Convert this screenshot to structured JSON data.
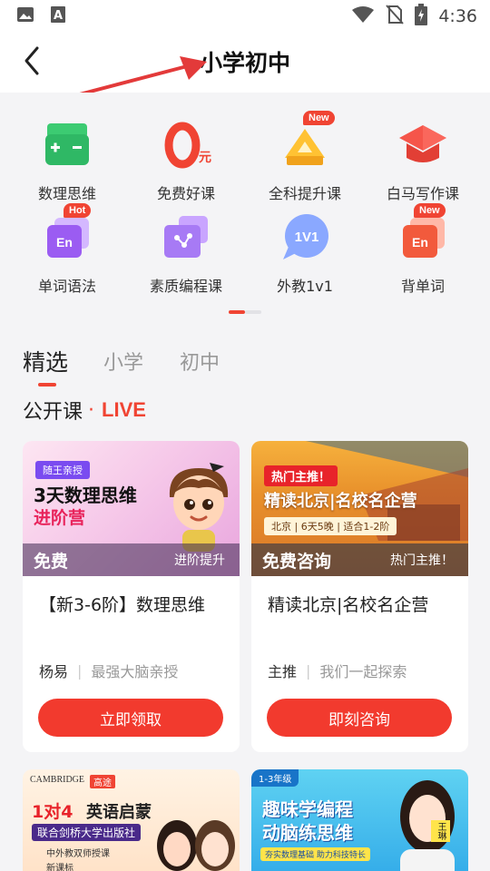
{
  "status_bar": {
    "time": "4:36",
    "icons": [
      "image-icon",
      "text-a-icon",
      "wifi-icon",
      "no-sim-icon",
      "battery-charging-icon"
    ]
  },
  "header": {
    "title": "小学初中",
    "back_icon": "chevron-left-icon"
  },
  "categories": [
    {
      "label": "数理思维",
      "icon": "calculator-icon",
      "tag": ""
    },
    {
      "label": "免费好课",
      "icon": "zero-yuan-icon",
      "tag": ""
    },
    {
      "label": "全科提升课",
      "icon": "triangle-book-icon",
      "tag": "New"
    },
    {
      "label": "白马写作课",
      "icon": "graduation-cap-icon",
      "tag": ""
    },
    {
      "label": "单词语法",
      "icon": "en-card-icon",
      "tag": "Hot"
    },
    {
      "label": "素质编程课",
      "icon": "coding-icon",
      "tag": ""
    },
    {
      "label": "外教1v1",
      "icon": "chat-1v1-icon",
      "tag": ""
    },
    {
      "label": "背单词",
      "icon": "en-word-icon",
      "tag": "New"
    }
  ],
  "tabs": [
    {
      "label": "精选",
      "active": true
    },
    {
      "label": "小学",
      "active": false
    },
    {
      "label": "初中",
      "active": false
    }
  ],
  "section": {
    "title": "公开课",
    "live_label": "LIVE"
  },
  "cards": [
    {
      "cover_tag": "随王亲授",
      "cover_title_line1": "3天数理思维",
      "cover_title_line2": "进阶营",
      "cover_main": "免费",
      "cover_sub": "进阶提升",
      "title": "【新3-6阶】数理思维",
      "teacher": "杨易",
      "desc": "最强大脑亲授",
      "button": "立即领取"
    },
    {
      "cover_tag": "热门主推！",
      "cover_title": "精读北京|名校名企营",
      "cover_info": "北京 | 6天5晚 | 适合1-2阶",
      "cover_main": "免费咨询",
      "cover_sub": "热门主推！",
      "title": "精读北京|名校名企营",
      "teacher": "主推",
      "desc": "我们一起探索",
      "button": "即刻咨询"
    }
  ],
  "more_cards": [
    {
      "publisher": "CAMBRIDGE",
      "tag1": "高途",
      "title_a": "1对4",
      "title_b": "英语启蒙",
      "subtitle": "联合剑桥大学出版社",
      "bullet1": "中外教双师授课",
      "bullet2": "新课标"
    },
    {
      "grade": "1-3年级",
      "title_line1": "趣味学编程",
      "title_line2": "动脑练思维",
      "subtitle": "夯实数理基础 助力科技特长",
      "teacher": "王琳"
    }
  ],
  "colors": {
    "accent": "#f04433",
    "button": "#f23a2e",
    "background": "#f4f4f6"
  }
}
